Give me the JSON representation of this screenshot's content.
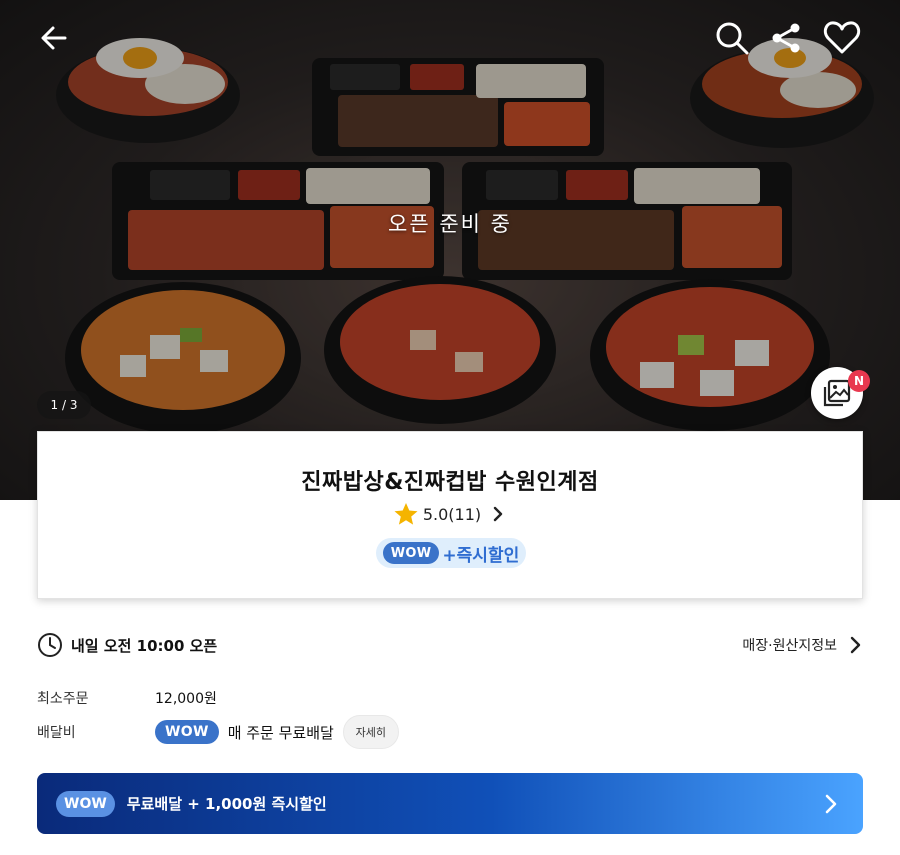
{
  "hero": {
    "status_text": "오픈 준비 중",
    "image_counter": "1 / 3",
    "new_badge": "N",
    "icons": [
      "back-arrow-icon",
      "search-icon",
      "share-icon",
      "heart-icon",
      "gallery-icon"
    ]
  },
  "store": {
    "name": "진짜밥상&진짜컵밥 수원인계점",
    "rating": "5.0(11)",
    "promo_badge": "WOW",
    "promo_text": "+즉시할인"
  },
  "info": {
    "open_time": "내일 오전 10:00 오픈",
    "store_info_link": "매장·원산지정보",
    "min_order_label": "최소주문",
    "min_order_value": "12,000원",
    "delivery_fee_label": "배달비",
    "delivery_badge": "WOW",
    "delivery_fee_text": "매 주문 무료배달",
    "detail_button": "자세히"
  },
  "banner": {
    "badge": "WOW",
    "text": "무료배달 + 1,000원 즉시할인"
  },
  "colors": {
    "wow_blue": "#3a73c9",
    "promo_text_blue": "#2f6dd1",
    "banner_start": "#0a2a7a",
    "banner_end": "#4aa3ff",
    "new_badge_red": "#e8384f",
    "star_yellow": "#f5b400"
  }
}
